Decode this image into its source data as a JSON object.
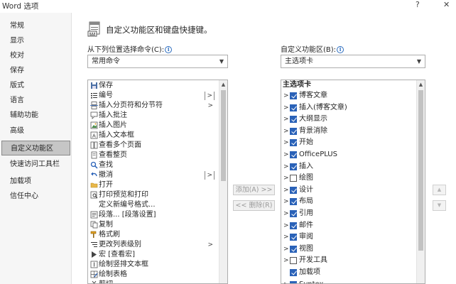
{
  "window": {
    "title": "Word 选项",
    "help": "?",
    "close": "✕"
  },
  "nav": {
    "items": [
      {
        "label": "常规"
      },
      {
        "label": "显示"
      },
      {
        "label": "校对"
      },
      {
        "label": "保存"
      },
      {
        "label": "版式"
      },
      {
        "label": "语言"
      },
      {
        "label": "辅助功能"
      },
      {
        "label": "高级"
      },
      {
        "label": "自定义功能区",
        "selected": true
      },
      {
        "label": "快速访问工具栏"
      },
      {
        "label": "加载项"
      },
      {
        "label": "信任中心"
      }
    ]
  },
  "header": {
    "text": "自定义功能区和键盘快捷键。"
  },
  "left_panel": {
    "label": "从下列位置选择命令(C):",
    "dropdown_value": "常用命令",
    "commands": [
      {
        "label": "保存",
        "icon": "save-icon",
        "sub": ""
      },
      {
        "label": "编号",
        "icon": "numbering-icon",
        "sub": "|>"
      },
      {
        "label": "插入分页符和分节符",
        "icon": "page-break-icon",
        "sub": ">"
      },
      {
        "label": "插入批注",
        "icon": "comment-icon",
        "sub": ""
      },
      {
        "label": "插入图片",
        "icon": "picture-icon",
        "sub": ""
      },
      {
        "label": "插入文本框",
        "icon": "textbox-icon",
        "sub": ""
      },
      {
        "label": "查看多个页面",
        "icon": "multipage-icon",
        "sub": ""
      },
      {
        "label": "查看整页",
        "icon": "onepage-icon",
        "sub": ""
      },
      {
        "label": "查找",
        "icon": "find-icon",
        "sub": ""
      },
      {
        "label": "撤消",
        "icon": "undo-icon",
        "sub": "|>"
      },
      {
        "label": "打开",
        "icon": "open-icon",
        "sub": ""
      },
      {
        "label": "打印预览和打印",
        "icon": "print-preview-icon",
        "sub": ""
      },
      {
        "label": "定义新编号格式...",
        "icon": "",
        "sub": ""
      },
      {
        "label": "段落... [段落设置]",
        "icon": "paragraph-icon",
        "sub": ""
      },
      {
        "label": "复制",
        "icon": "copy-icon",
        "sub": ""
      },
      {
        "label": "格式刷",
        "icon": "format-painter-icon",
        "sub": ""
      },
      {
        "label": "更改列表级别",
        "icon": "list-level-icon",
        "sub": ">"
      },
      {
        "label": "宏 [查看宏]",
        "icon": "macro-icon",
        "sub": ""
      },
      {
        "label": "绘制竖排文本框",
        "icon": "vertical-textbox-icon",
        "sub": ""
      },
      {
        "label": "绘制表格",
        "icon": "draw-table-icon",
        "sub": ""
      },
      {
        "label": "剪切",
        "icon": "cut-icon",
        "sub": ""
      }
    ]
  },
  "middle": {
    "add": "添加(A) >>",
    "remove": "<< 删除(R)"
  },
  "right_panel": {
    "label": "自定义功能区(B):",
    "dropdown_value": "主选项卡",
    "tree_header": "主选项卡",
    "tabs": [
      {
        "label": "博客文章",
        "checked": true,
        "expander": true
      },
      {
        "label": "插入(博客文章)",
        "checked": true,
        "expander": true
      },
      {
        "label": "大纲显示",
        "checked": true,
        "expander": true
      },
      {
        "label": "背景消除",
        "checked": true,
        "expander": true
      },
      {
        "label": "开始",
        "checked": true,
        "expander": true
      },
      {
        "label": "OfficePLUS",
        "checked": true,
        "expander": true
      },
      {
        "label": "插入",
        "checked": true,
        "expander": true
      },
      {
        "label": "绘图",
        "checked": false,
        "expander": true
      },
      {
        "label": "设计",
        "checked": true,
        "expander": true
      },
      {
        "label": "布局",
        "checked": true,
        "expander": true
      },
      {
        "label": "引用",
        "checked": true,
        "expander": true
      },
      {
        "label": "邮件",
        "checked": true,
        "expander": true
      },
      {
        "label": "审阅",
        "checked": true,
        "expander": true
      },
      {
        "label": "视图",
        "checked": true,
        "expander": true
      },
      {
        "label": "开发工具",
        "checked": false,
        "expander": true
      },
      {
        "label": "加载项",
        "checked": true,
        "expander": false
      },
      {
        "label": "Syntex",
        "checked": true,
        "expander": true
      }
    ]
  },
  "colors": {
    "accent": "#2a62b8",
    "nav_selected": "#c6c6c6"
  }
}
